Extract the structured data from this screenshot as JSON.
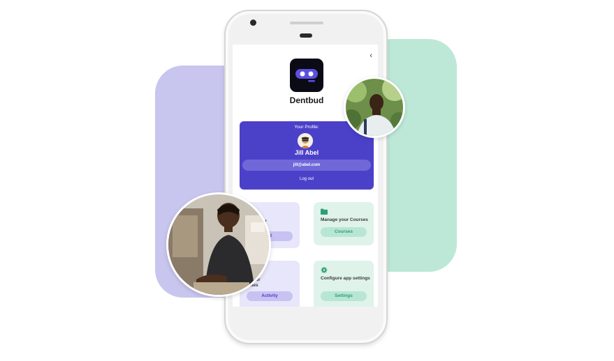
{
  "app": {
    "name": "Dentbud",
    "back_icon": "chevron-left-icon"
  },
  "profile": {
    "label": "Your Profile:",
    "name": "Jill Abel",
    "email": "jill@abel.com",
    "logout_label": "Log out"
  },
  "tiles": [
    {
      "title": "with your",
      "button": "nt",
      "icon": "chat-icon"
    },
    {
      "title": "Manage your Courses",
      "button": "Courses",
      "icon": "folder-icon"
    },
    {
      "title": "e your\nvities",
      "button": "Activity",
      "icon": "activity-icon"
    },
    {
      "title": "Configure app settings",
      "button": "Settings",
      "icon": "gear-icon"
    }
  ],
  "colors": {
    "brand": "#4b41c9",
    "accent_green": "#2f9e73",
    "blob_purple": "#c8c6ee",
    "blob_green": "#bde8d8"
  }
}
